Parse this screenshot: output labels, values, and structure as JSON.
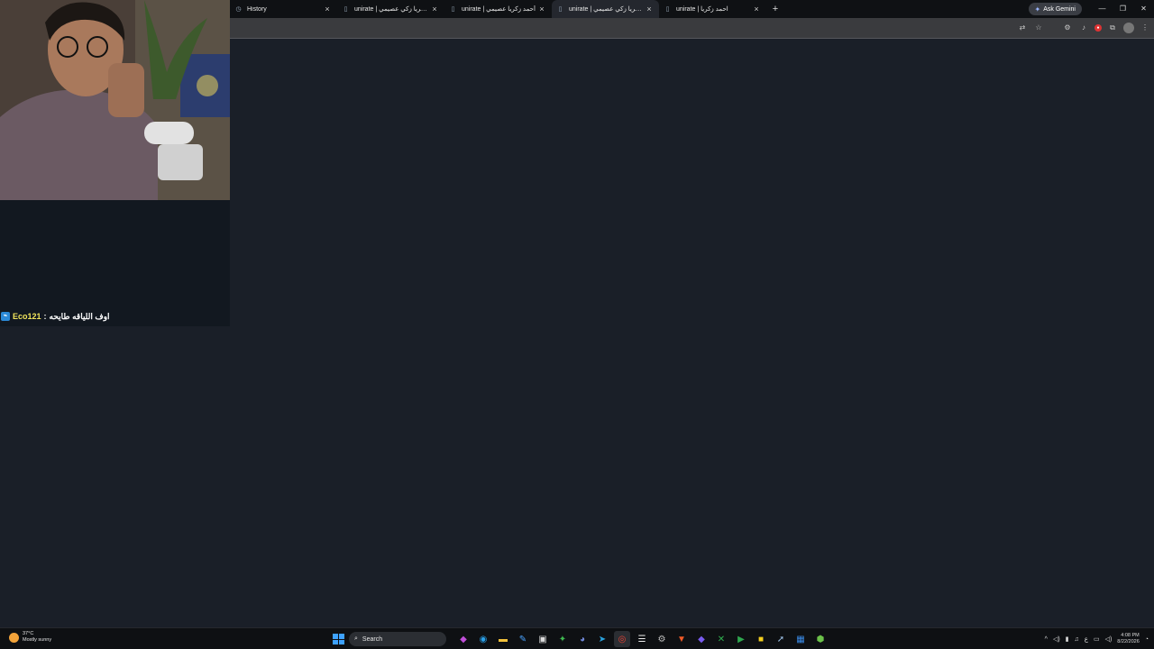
{
  "tabs": [
    {
      "title": "History",
      "close": "×"
    },
    {
      "title": "unirate | احمد زكريا زكي عصيمي",
      "close": "×"
    },
    {
      "title": "unirate | أحمد زكريا عصيمي",
      "close": "×"
    },
    {
      "title": "unirate | احمد زكريا زكي عصيمي",
      "close": "×",
      "active": true
    },
    {
      "title": "unirate | احمد زكريا",
      "close": "×"
    }
  ],
  "new_tab": "+",
  "gemini_label": "Ask Gemini",
  "window_controls": {
    "minimize": "—",
    "restore": "❐",
    "close": "✕"
  },
  "chat": {
    "username": "Eco121",
    "separator": " : ",
    "message": "اوف اللياقه طايحه"
  },
  "weather": {
    "temp": "37°C",
    "condition": "Mostly sunny"
  },
  "taskbar": {
    "search_placeholder": "Search"
  },
  "clock": {
    "time": "4:08 PM",
    "date": "8/22/2026"
  },
  "tray": {
    "lang": "ع"
  },
  "colors": {
    "accent": "#3ea2ff",
    "page_bg": "#1a1f28",
    "chat_user": "#f2e55c"
  }
}
